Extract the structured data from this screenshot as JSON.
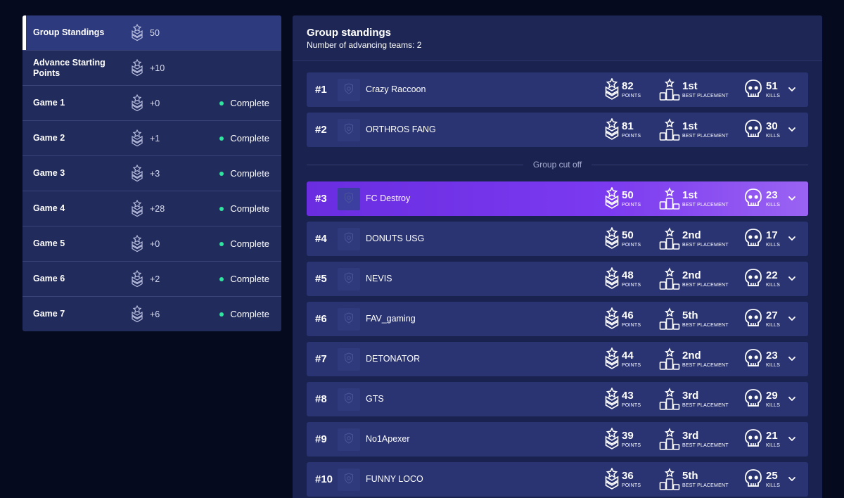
{
  "sidebar": {
    "items": [
      {
        "label": "Group Standings",
        "value": "50",
        "status": "",
        "active": true
      },
      {
        "label": "Advance Starting Points",
        "value": "+10",
        "status": ""
      },
      {
        "label": "Game 1",
        "value": "+0",
        "status": "Complete"
      },
      {
        "label": "Game 2",
        "value": "+1",
        "status": "Complete"
      },
      {
        "label": "Game 3",
        "value": "+3",
        "status": "Complete"
      },
      {
        "label": "Game 4",
        "value": "+28",
        "status": "Complete"
      },
      {
        "label": "Game 5",
        "value": "+0",
        "status": "Complete"
      },
      {
        "label": "Game 6",
        "value": "+2",
        "status": "Complete"
      },
      {
        "label": "Game 7",
        "value": "+6",
        "status": "Complete"
      }
    ],
    "icon": "medal-chevron-icon",
    "status_color": "#2ee59d"
  },
  "panel": {
    "title": "Group standings",
    "subtitle": "Number of advancing teams: 2",
    "cutoff_label": "Group cut off",
    "labels": {
      "points": "POINTS",
      "best_placement": "BEST PLACEMENT",
      "kills": "KILLS"
    },
    "highlight_color": "#7b3af0",
    "rows": [
      {
        "rank": "#1",
        "team": "Crazy Raccoon",
        "points": "82",
        "placement": "1st",
        "kills": "51"
      },
      {
        "rank": "#2",
        "team": "ORTHROS FANG",
        "points": "81",
        "placement": "1st",
        "kills": "30"
      },
      {
        "rank": "#3",
        "team": "FC Destroy",
        "points": "50",
        "placement": "1st",
        "kills": "23",
        "highlight": true
      },
      {
        "rank": "#4",
        "team": "DONUTS USG",
        "points": "50",
        "placement": "2nd",
        "kills": "17"
      },
      {
        "rank": "#5",
        "team": "NEVIS",
        "points": "48",
        "placement": "2nd",
        "kills": "22"
      },
      {
        "rank": "#6",
        "team": "FAV_gaming",
        "points": "46",
        "placement": "5th",
        "kills": "27"
      },
      {
        "rank": "#7",
        "team": "DETONATOR",
        "points": "44",
        "placement": "2nd",
        "kills": "23"
      },
      {
        "rank": "#8",
        "team": "GTS",
        "points": "43",
        "placement": "3rd",
        "kills": "29"
      },
      {
        "rank": "#9",
        "team": "No1Apexer",
        "points": "39",
        "placement": "3rd",
        "kills": "21"
      },
      {
        "rank": "#10",
        "team": "FUNNY LOCO",
        "points": "36",
        "placement": "5th",
        "kills": "25"
      }
    ]
  }
}
